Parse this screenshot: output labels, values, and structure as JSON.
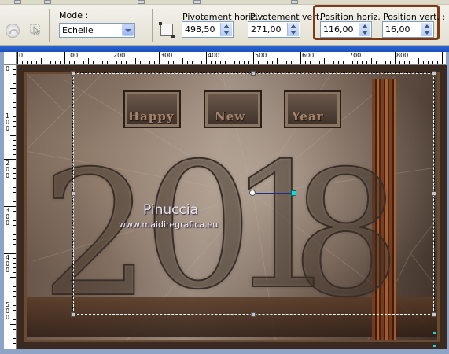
{
  "toolbar": {
    "mode": {
      "label": "Mode :",
      "value": "Echelle"
    },
    "pivot_h": {
      "label": "Pivotement horiz. :",
      "value": "498,50"
    },
    "pivot_v": {
      "label": "Pivotement vert. :",
      "value": "271,00"
    },
    "pos_h": {
      "label": "Position horiz. :",
      "value": "116,00"
    },
    "pos_v": {
      "label": "Position vert. :",
      "value": "16,00"
    },
    "highlight_color": "#7b3b18"
  },
  "ruler": {
    "horizontal": [
      "0",
      "100",
      "200",
      "300",
      "400",
      "500",
      "600",
      "700",
      "800"
    ],
    "vertical": [
      "0",
      "100",
      "200",
      "300",
      "400",
      "500"
    ]
  },
  "canvas": {
    "words": [
      "Happy",
      "New",
      "Year"
    ],
    "year_digits": [
      "2",
      "0",
      "1",
      "8"
    ],
    "watermark_name": "Pinuccia",
    "watermark_url": "www.maidiregrafica.eu"
  },
  "icons": {
    "undo": "undo-icon",
    "pick": "pick-tool-icon",
    "rotation": "rotation-icon"
  }
}
